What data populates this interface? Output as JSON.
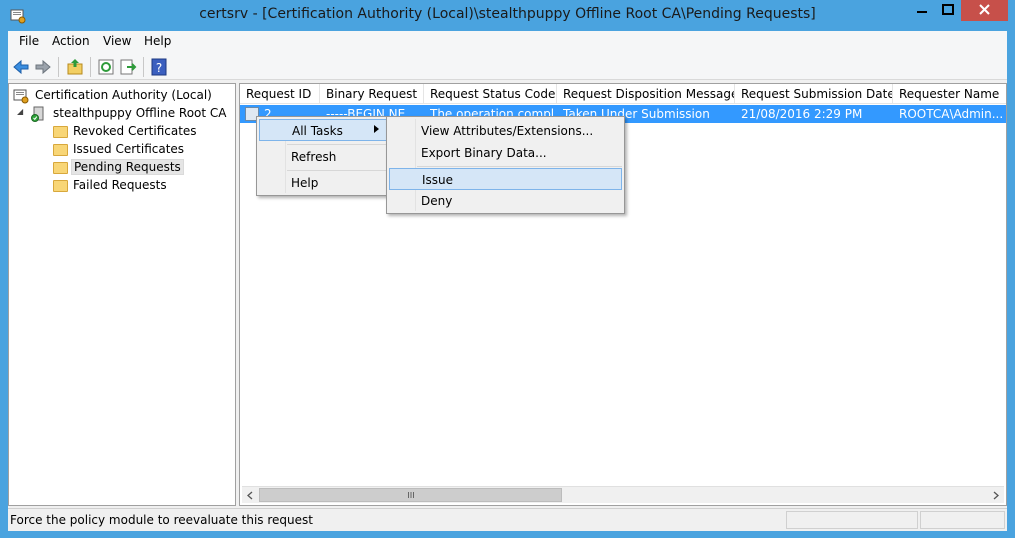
{
  "window": {
    "title": "certsrv - [Certification Authority (Local)\\stealthpuppy Offline Root CA\\Pending Requests]"
  },
  "menubar": {
    "items": [
      "File",
      "Action",
      "View",
      "Help"
    ]
  },
  "toolbar": {
    "icons": [
      "back-arrow-icon",
      "forward-arrow-icon",
      "up-folder-icon",
      "refresh-icon",
      "export-list-icon",
      "help-icon"
    ]
  },
  "tree": {
    "root": "Certification Authority (Local)",
    "ca": "stealthpuppy Offline Root CA",
    "expander": "◢",
    "folders": [
      "Revoked Certificates",
      "Issued Certificates",
      "Pending Requests",
      "Failed Requests"
    ],
    "selected": "Pending Requests"
  },
  "list": {
    "columns": [
      "Request ID",
      "Binary Request",
      "Request Status Code",
      "Request Disposition Message",
      "Request Submission Date",
      "Requester Name"
    ],
    "rows": [
      {
        "request_id": "2",
        "binary_request": "-----BEGIN NE...",
        "status_code": "The operation compl...",
        "disposition": "Taken Under Submission",
        "submission_date": "21/08/2016 2:29 PM",
        "requester": "ROOTCA\\Admin..."
      }
    ],
    "selected_row_color": "#3399ff"
  },
  "context_menu": {
    "items": [
      "All Tasks",
      "Refresh",
      "Help"
    ],
    "highlighted": "All Tasks",
    "submenu": {
      "items": [
        "View Attributes/Extensions...",
        "Export Binary Data...",
        "Issue",
        "Deny"
      ],
      "highlighted": "Issue"
    }
  },
  "statusbar": {
    "text": "Force the policy module to reevaluate this request"
  },
  "colors": {
    "title_bar": "#4aa3df",
    "close_button": "#c7504a",
    "selection": "#3399ff",
    "menu_highlight": "#d5e6f7"
  }
}
